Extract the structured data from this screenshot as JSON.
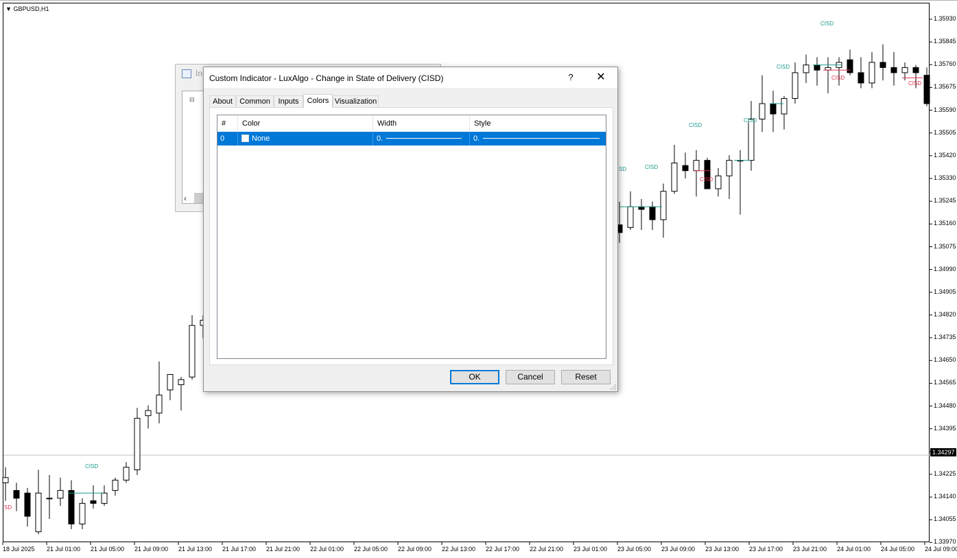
{
  "chart": {
    "symbol": "GBPUSD,H1",
    "current_price": "1.34297",
    "price_axis": [
      "1.35930",
      "1.35845",
      "1.35760",
      "1.35675",
      "1.35590",
      "1.35505",
      "1.35420",
      "1.35330",
      "1.35245",
      "1.35160",
      "1.35075",
      "1.34990",
      "1.34905",
      "1.34820",
      "1.34735",
      "1.34650",
      "1.34565",
      "1.34480",
      "1.34395",
      "1.34310",
      "1.34225",
      "1.34140",
      "1.34055",
      "1.33970"
    ],
    "time_axis": [
      "18 Jul 2025",
      "21 Jul 01:00",
      "21 Jul 05:00",
      "21 Jul 09:00",
      "21 Jul 13:00",
      "21 Jul 17:00",
      "21 Jul 21:00",
      "22 Jul 01:00",
      "22 Jul 05:00",
      "22 Jul 09:00",
      "22 Jul 13:00",
      "22 Jul 17:00",
      "22 Jul 21:00",
      "23 Jul 01:00",
      "23 Jul 05:00",
      "23 Jul 09:00",
      "23 Jul 13:00",
      "23 Jul 17:00",
      "23 Jul 21:00",
      "24 Jul 01:00",
      "24 Jul 05:00",
      "24 Jul 09:00"
    ],
    "cisd_bull_label": "CISD",
    "cisd_bear_label": "CISD",
    "cisd_partial_left": "SD",
    "cisd_partial_mid": "SD",
    "bull_color": "#1a9a8c",
    "bear_color": "#e0304a"
  },
  "chart_data": {
    "type": "candlestick",
    "symbol": "GBPUSD,H1",
    "current_price": 1.34297,
    "ylim": [
      1.3397,
      1.3599
    ],
    "candles_left": [
      [
        1.3419,
        1.3425,
        1.3412,
        1.3421
      ],
      [
        1.3416,
        1.3419,
        1.3408,
        1.3413
      ],
      [
        1.3415,
        1.3417,
        1.3402,
        1.3406
      ],
      [
        1.34,
        1.3424,
        1.3399,
        1.3415
      ],
      [
        1.3413,
        1.3422,
        1.3405,
        1.3413
      ],
      [
        1.3413,
        1.3421,
        1.341,
        1.3416
      ],
      [
        1.3416,
        1.342,
        1.3401,
        1.3403
      ],
      [
        1.3403,
        1.3413,
        1.3401,
        1.3411
      ],
      [
        1.3412,
        1.3418,
        1.3409,
        1.3411
      ],
      [
        1.3411,
        1.3418,
        1.341,
        1.3415
      ],
      [
        1.3416,
        1.3421,
        1.3414,
        1.342
      ],
      [
        1.342,
        1.3427,
        1.3419,
        1.3425
      ],
      [
        1.3424,
        1.3448,
        1.3422,
        1.3444
      ],
      [
        1.3445,
        1.3449,
        1.344,
        1.3447
      ],
      [
        1.3446,
        1.3466,
        1.3442,
        1.3453
      ],
      [
        1.3455,
        1.3461,
        1.3451,
        1.3461
      ],
      [
        1.3457,
        1.346,
        1.3447,
        1.3459
      ],
      [
        1.346,
        1.3484,
        1.3459,
        1.348
      ],
      [
        1.348,
        1.3484,
        1.3475,
        1.3482
      ]
    ],
    "candles_right": [
      [
        1.3519,
        1.3528,
        1.3512,
        1.3516
      ],
      [
        1.3518,
        1.3532,
        1.3517,
        1.3526
      ],
      [
        1.3526,
        1.3529,
        1.3517,
        1.3525
      ],
      [
        1.3526,
        1.3528,
        1.3517,
        1.3521
      ],
      [
        1.3521,
        1.3535,
        1.3514,
        1.3532
      ],
      [
        1.3532,
        1.355,
        1.3531,
        1.3543
      ],
      [
        1.3542,
        1.3547,
        1.3537,
        1.354
      ],
      [
        1.354,
        1.3548,
        1.353,
        1.3544
      ],
      [
        1.3544,
        1.3545,
        1.3533,
        1.3533
      ],
      [
        1.3533,
        1.3541,
        1.353,
        1.3538
      ],
      [
        1.3538,
        1.3546,
        1.3529,
        1.3544
      ],
      [
        1.3544,
        1.3548,
        1.3523,
        1.3544
      ],
      [
        1.3544,
        1.3567,
        1.354,
        1.356
      ],
      [
        1.356,
        1.3577,
        1.3555,
        1.3566
      ],
      [
        1.3566,
        1.3571,
        1.3555,
        1.3562
      ],
      [
        1.3562,
        1.3569,
        1.3556,
        1.3568
      ],
      [
        1.3568,
        1.3582,
        1.3566,
        1.3578
      ],
      [
        1.3578,
        1.3585,
        1.3574,
        1.3581
      ],
      [
        1.3581,
        1.3584,
        1.3573,
        1.3579
      ],
      [
        1.3579,
        1.3584,
        1.357,
        1.358
      ],
      [
        1.358,
        1.3584,
        1.3573,
        1.3582
      ],
      [
        1.3583,
        1.3587,
        1.3577,
        1.3578
      ],
      [
        1.3578,
        1.3584,
        1.3572,
        1.3574
      ],
      [
        1.3574,
        1.3586,
        1.3572,
        1.3582
      ],
      [
        1.3582,
        1.3589,
        1.3575,
        1.358
      ],
      [
        1.358,
        1.3586,
        1.3573,
        1.3578
      ],
      [
        1.3578,
        1.3582,
        1.3575,
        1.358
      ],
      [
        1.358,
        1.3581,
        1.3572,
        1.3578
      ],
      [
        1.3577,
        1.358,
        1.3565,
        1.3566
      ]
    ]
  },
  "background_dialog": {
    "title": "In",
    "tree_expander": "⊟"
  },
  "dialog": {
    "title": "Custom Indicator - LuxAlgo - Change in State of Delivery (CISD)",
    "help_label": "?",
    "close_label": "✕",
    "tabs": [
      {
        "label": "About"
      },
      {
        "label": "Common"
      },
      {
        "label": "Inputs"
      },
      {
        "label": "Colors"
      },
      {
        "label": "Visualization"
      }
    ],
    "active_tab": "Colors",
    "grid": {
      "headers": [
        "#",
        "Color",
        "Width",
        "Style"
      ],
      "rows": [
        {
          "index": "0",
          "color": "None",
          "width": "0.",
          "style": "0."
        }
      ]
    },
    "buttons": {
      "ok": "OK",
      "cancel": "Cancel",
      "reset": "Reset"
    }
  }
}
